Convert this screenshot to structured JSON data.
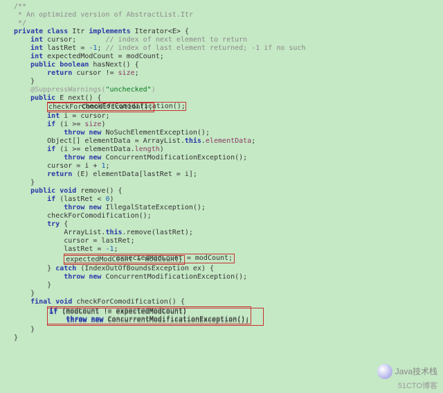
{
  "code": {
    "l01": "/**",
    "l02": " * An optimized version of AbstractList.Itr",
    "l03": " */",
    "l04a": "private class",
    "l04b": " Itr ",
    "l04c": "implements",
    "l04d": " Iterator<E> {",
    "l05a": "    int",
    "l05b": " cursor;       ",
    "l05c": "// index of next element to return",
    "l06a": "    int",
    "l06b": " lastRet = ",
    "l06c": "-1",
    "l06d": "; ",
    "l06e": "// index of last element returned; -1 if no such",
    "l07a": "    int",
    "l07b": " expectedModCount = modCount;",
    "l08": "",
    "l09a": "    public boolean",
    "l09b": " hasNext() {",
    "l10a": "        return",
    "l10b": " cursor != ",
    "l10c": "size",
    "l10d": ";",
    "l11": "    }",
    "l12": "",
    "l13a": "    @SuppressWarnings(",
    "l13b": "\"unchecked\"",
    "l13c": ")",
    "l14a": "    public",
    "l14b": " E next() {",
    "l15": "        checkForComodification();",
    "l16a": "        int",
    "l16b": " i = cursor;",
    "l17a": "        if",
    "l17b": " (i >= ",
    "l17c": "size",
    "l17d": ")",
    "l18a": "            throw new",
    "l18b": " NoSuchElementException();",
    "l19a": "        Object[] elementData = ArrayList.",
    "l19b": "this",
    "l19c": ".",
    "l19d": "elementData",
    "l19e": ";",
    "l20a": "        if",
    "l20b": " (i >= elementData.",
    "l20c": "length",
    "l20d": ")",
    "l21a": "            throw new",
    "l21b": " ConcurrentModificationException();",
    "l22a": "        cursor = i + ",
    "l22b": "1",
    "l22c": ";",
    "l23a": "        return",
    "l23b": " (E) elementData[lastRet = i];",
    "l24": "    }",
    "l25": "",
    "l26a": "    public void",
    "l26b": " remove() {",
    "l27a": "        if",
    "l27b": " (lastRet < ",
    "l27c": "0",
    "l27d": ")",
    "l28a": "            throw new",
    "l28b": " IllegalStateException();",
    "l29": "        checkForComodification();",
    "l30": "",
    "l31a": "        try",
    "l31b": " {",
    "l32a": "            ArrayList.",
    "l32b": "this",
    "l32c": ".remove(lastRet);",
    "l33": "            cursor = lastRet;",
    "l34a": "            lastRet = ",
    "l34b": "-1",
    "l34c": ";",
    "l35": "            expectedModCount = modCount;",
    "l36a": "        } ",
    "l36b": "catch",
    "l36c": " (IndexOutOfBoundsException ex) {",
    "l37a": "            throw new",
    "l37b": " ConcurrentModificationException();",
    "l38": "        }",
    "l39": "    }",
    "l40": "",
    "l41a": "    final void",
    "l41b": " checkForComodification() {",
    "l42ia": "        ",
    "l42a": "if",
    "l42b": " (modCount != expectedModCount)",
    "l43a": "            throw new",
    "l43b": " ConcurrentModificationException();",
    "l44": "    }",
    "l45": "}"
  },
  "watermark": "Java技术栈",
  "attrib": "51CTO博客"
}
